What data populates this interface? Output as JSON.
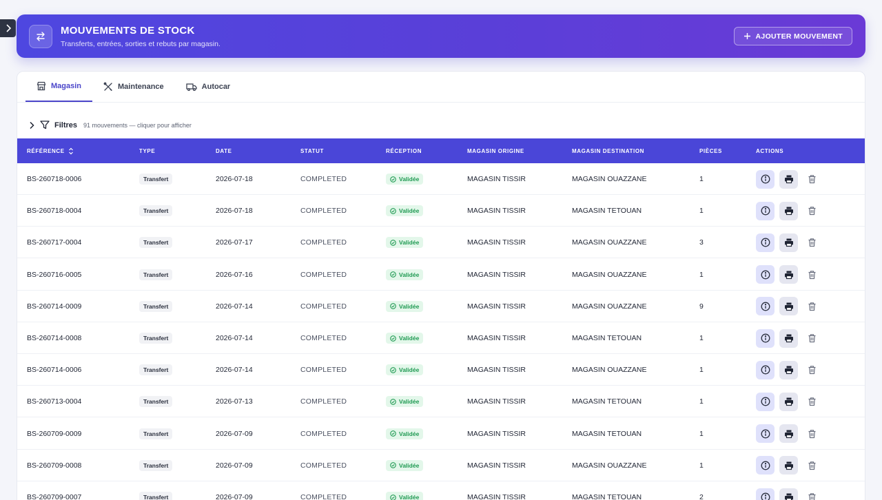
{
  "header": {
    "title": "MOUVEMENTS DE STOCK",
    "subtitle": "Transferts, entrées, sorties et rebuts par magasin.",
    "add_button": "AJOUTER MOUVEMENT"
  },
  "tabs": [
    {
      "label": "Magasin",
      "icon": "store-icon",
      "active": true
    },
    {
      "label": "Maintenance",
      "icon": "tools-icon",
      "active": false
    },
    {
      "label": "Autocar",
      "icon": "truck-icon",
      "active": false
    }
  ],
  "filters": {
    "label": "Filtres",
    "hint": "91 mouvements — cliquer pour afficher"
  },
  "table": {
    "columns": [
      "RÉFÉRENCE",
      "TYPE",
      "DATE",
      "STATUT",
      "RÉCEPTION",
      "MAGASIN ORIGINE",
      "MAGASIN DESTINATION",
      "PIÈCES",
      "ACTIONS"
    ],
    "rows": [
      {
        "ref": "BS-260718-0006",
        "type": "Transfert",
        "date": "2026-07-18",
        "status": "COMPLETED",
        "reception": "Validée",
        "origin": "MAGASIN TISSIR",
        "destination": "MAGASIN OUAZZANE",
        "pieces": "1"
      },
      {
        "ref": "BS-260718-0004",
        "type": "Transfert",
        "date": "2026-07-18",
        "status": "COMPLETED",
        "reception": "Validée",
        "origin": "MAGASIN TISSIR",
        "destination": "MAGASIN TETOUAN",
        "pieces": "1"
      },
      {
        "ref": "BS-260717-0004",
        "type": "Transfert",
        "date": "2026-07-17",
        "status": "COMPLETED",
        "reception": "Validée",
        "origin": "MAGASIN TISSIR",
        "destination": "MAGASIN OUAZZANE",
        "pieces": "3"
      },
      {
        "ref": "BS-260716-0005",
        "type": "Transfert",
        "date": "2026-07-16",
        "status": "COMPLETED",
        "reception": "Validée",
        "origin": "MAGASIN TISSIR",
        "destination": "MAGASIN OUAZZANE",
        "pieces": "1"
      },
      {
        "ref": "BS-260714-0009",
        "type": "Transfert",
        "date": "2026-07-14",
        "status": "COMPLETED",
        "reception": "Validée",
        "origin": "MAGASIN TISSIR",
        "destination": "MAGASIN OUAZZANE",
        "pieces": "9"
      },
      {
        "ref": "BS-260714-0008",
        "type": "Transfert",
        "date": "2026-07-14",
        "status": "COMPLETED",
        "reception": "Validée",
        "origin": "MAGASIN TISSIR",
        "destination": "MAGASIN TETOUAN",
        "pieces": "1"
      },
      {
        "ref": "BS-260714-0006",
        "type": "Transfert",
        "date": "2026-07-14",
        "status": "COMPLETED",
        "reception": "Validée",
        "origin": "MAGASIN TISSIR",
        "destination": "MAGASIN OUAZZANE",
        "pieces": "1"
      },
      {
        "ref": "BS-260713-0004",
        "type": "Transfert",
        "date": "2026-07-13",
        "status": "COMPLETED",
        "reception": "Validée",
        "origin": "MAGASIN TISSIR",
        "destination": "MAGASIN TETOUAN",
        "pieces": "1"
      },
      {
        "ref": "BS-260709-0009",
        "type": "Transfert",
        "date": "2026-07-09",
        "status": "COMPLETED",
        "reception": "Validée",
        "origin": "MAGASIN TISSIR",
        "destination": "MAGASIN TETOUAN",
        "pieces": "1"
      },
      {
        "ref": "BS-260709-0008",
        "type": "Transfert",
        "date": "2026-07-09",
        "status": "COMPLETED",
        "reception": "Validée",
        "origin": "MAGASIN TISSIR",
        "destination": "MAGASIN OUAZZANE",
        "pieces": "1"
      },
      {
        "ref": "BS-260709-0007",
        "type": "Transfert",
        "date": "2026-07-09",
        "status": "COMPLETED",
        "reception": "Validée",
        "origin": "MAGASIN TISSIR",
        "destination": "MAGASIN TETOUAN",
        "pieces": "2"
      }
    ]
  },
  "colors": {
    "accent": "#4a46d8",
    "validated": "#1f9a52"
  }
}
